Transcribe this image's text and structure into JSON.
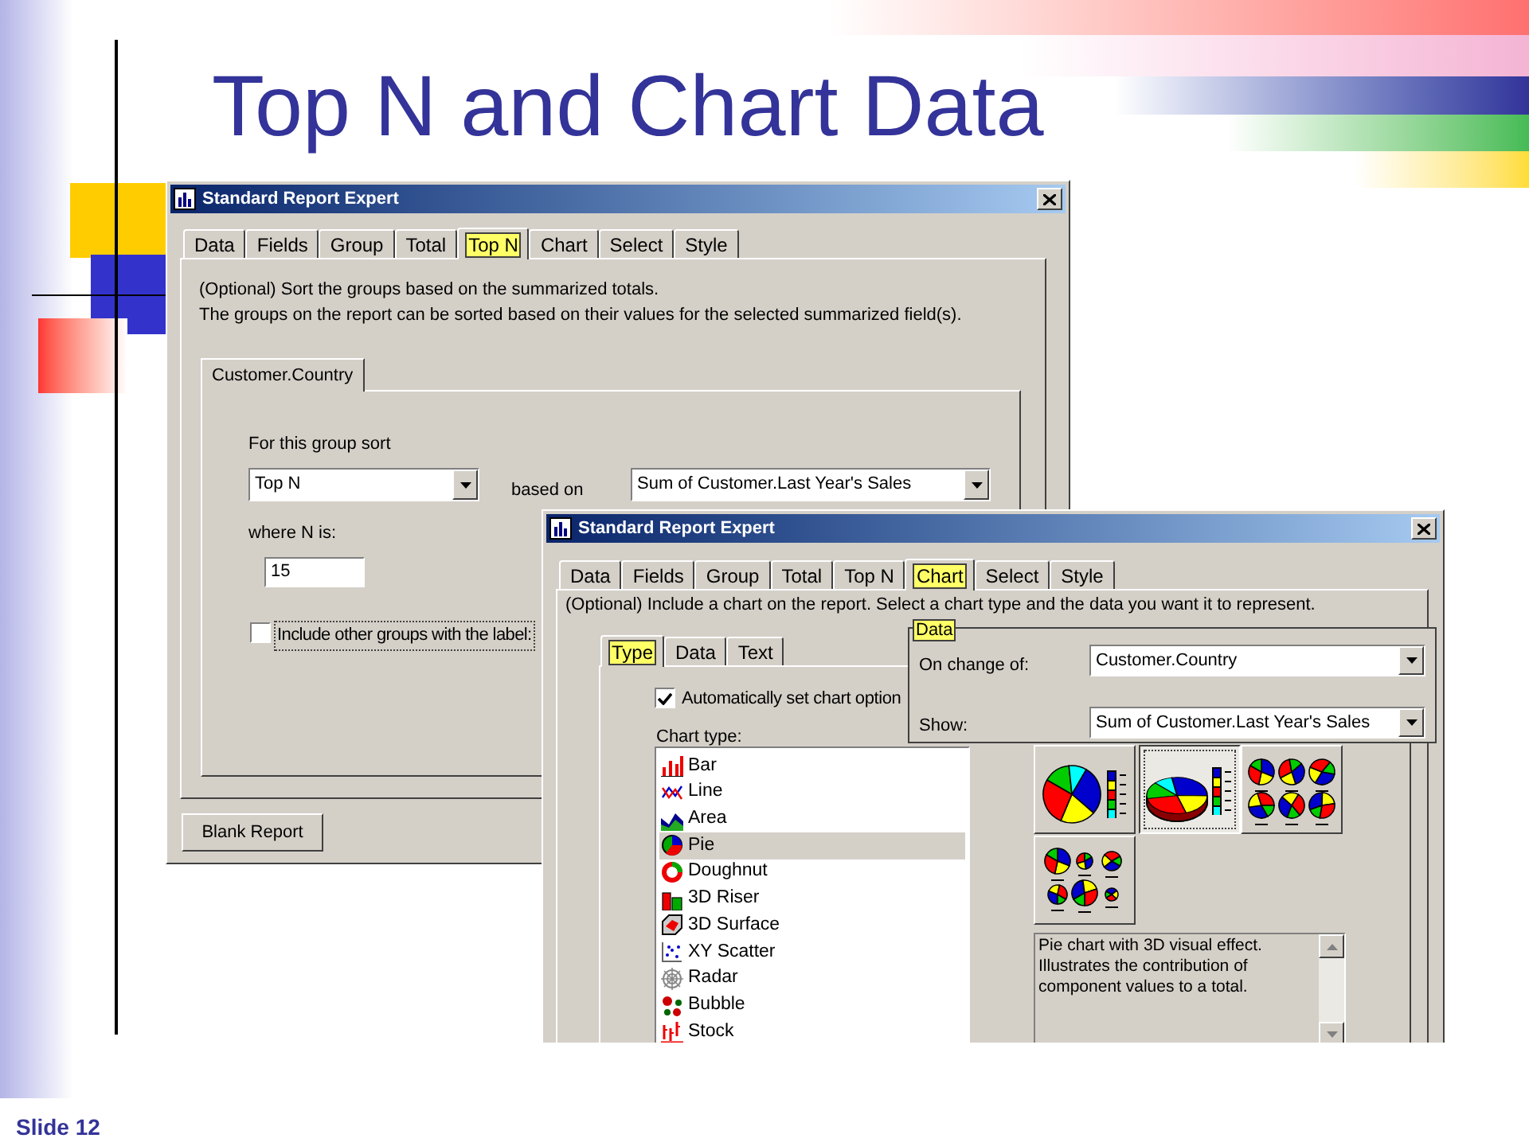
{
  "slide": {
    "title": "Top N and Chart Data",
    "footer": "Slide 12"
  },
  "top_n_window": {
    "title": "Standard Report Expert",
    "tabs": [
      {
        "label": "Data",
        "selected": false
      },
      {
        "label": "Fields",
        "selected": false
      },
      {
        "label": "Group",
        "selected": false
      },
      {
        "label": "Total",
        "selected": false
      },
      {
        "label": "Top N",
        "selected": true
      },
      {
        "label": "Chart",
        "selected": false
      },
      {
        "label": "Select",
        "selected": false
      },
      {
        "label": "Style",
        "selected": false
      }
    ],
    "description": [
      "(Optional) Sort the groups based on the summarized totals.",
      "The groups on the report can be sorted based on their values for the selected summarized field(s)."
    ],
    "group_tabs": [
      {
        "label": "Customer.Country",
        "selected": true
      }
    ],
    "sort_label": "For this group sort",
    "sort_value": "Top N",
    "based_on_label": "based on",
    "based_on_value": "Sum of Customer.Last Year's Sales",
    "n_label": "where N is:",
    "n_value": "15",
    "include_others": {
      "label": "Include other groups with the label:",
      "checked": false
    },
    "buttons": [
      "Blank Report"
    ]
  },
  "chart_window": {
    "title": "Standard Report Expert",
    "tabs": [
      {
        "label": "Data",
        "selected": false
      },
      {
        "label": "Fields",
        "selected": false
      },
      {
        "label": "Group",
        "selected": false
      },
      {
        "label": "Total",
        "selected": false
      },
      {
        "label": "Top N",
        "selected": false
      },
      {
        "label": "Chart",
        "selected": true
      },
      {
        "label": "Select",
        "selected": false
      },
      {
        "label": "Style",
        "selected": false
      }
    ],
    "description": "(Optional) Include a chart on the report. Select a chart type and the data you want it to represent.",
    "sub_tabs": [
      {
        "label": "Type",
        "selected": true
      },
      {
        "label": "Data",
        "selected": false
      },
      {
        "label": "Text",
        "selected": false
      }
    ],
    "auto_option": {
      "label": "Automatically set chart option",
      "checked": true
    },
    "data_group": {
      "legend": "Data",
      "on_change_label": "On change of:",
      "on_change_value": "Customer.Country",
      "show_label": "Show:",
      "show_value": "Sum of Customer.Last Year's Sales"
    },
    "chart_type_label": "Chart type:",
    "chart_types": [
      {
        "label": "Bar",
        "kind": "bar",
        "selected": false
      },
      {
        "label": "Line",
        "kind": "line",
        "selected": false
      },
      {
        "label": "Area",
        "kind": "area",
        "selected": false
      },
      {
        "label": "Pie",
        "kind": "pie",
        "selected": true
      },
      {
        "label": "Doughnut",
        "kind": "doughnut",
        "selected": false
      },
      {
        "label": "3D Riser",
        "kind": "riser",
        "selected": false
      },
      {
        "label": "3D Surface",
        "kind": "surface",
        "selected": false
      },
      {
        "label": "XY Scatter",
        "kind": "scatter",
        "selected": false
      },
      {
        "label": "Radar",
        "kind": "radar",
        "selected": false
      },
      {
        "label": "Bubble",
        "kind": "bubble",
        "selected": false
      },
      {
        "label": "Stock",
        "kind": "stock",
        "selected": false
      }
    ],
    "subtypes": [
      {
        "kind": "pie",
        "selected": false
      },
      {
        "kind": "pie3d",
        "selected": true
      },
      {
        "kind": "multi",
        "selected": false
      },
      {
        "kind": "multi_sized",
        "selected": false
      }
    ],
    "subtype_description": "Pie chart with 3D visual effect. Illustrates the contribution of component values to a total."
  }
}
